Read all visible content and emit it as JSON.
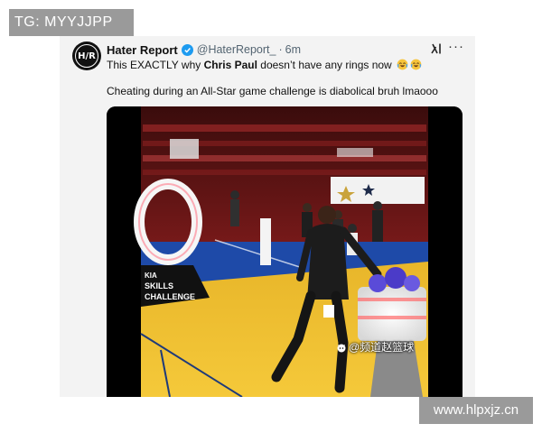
{
  "overlay": {
    "top_left_tag": "TG: MYYJJPP",
    "bottom_right_url": "www.hlpxjz.cn"
  },
  "tweet": {
    "avatar_monogram": "H/R",
    "display_name": "Hater Report",
    "handle": "@HaterReport_",
    "separator": "·",
    "time": "6m",
    "text_before": "This EXACTLY why ",
    "text_bold": "Chris Paul",
    "text_after": " doesn’t have any rings now",
    "emojis": [
      "crying-laughing-face",
      "crying-laughing-face"
    ],
    "line2": "Cheating during an All-Star game challenge is diabolical bruh lmaooo",
    "more_label": "···",
    "icons": {
      "verified": "verified-badge-icon",
      "grok": "grok-x-icon",
      "more": "more-options-icon"
    }
  },
  "video": {
    "court_logo_line1": "SKILLS",
    "court_logo_line2": "CHALLENGE",
    "watermark": "@频道赵篮球"
  },
  "colors": {
    "verified_blue": "#1d9bf0",
    "court_yellow": "#f2c12e",
    "court_blue": "#1e4aa8",
    "card_bg": "#f3f3f3",
    "tag_bg": "#9a9a9a"
  }
}
